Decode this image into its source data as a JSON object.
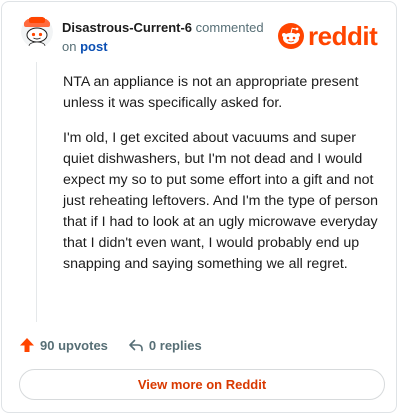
{
  "comment": {
    "author": "Disastrous-Current-6",
    "action_text": " commented on ",
    "post_link": "post",
    "paragraphs": [
      "NTA an appliance is not an appropriate present unless it was specifically asked for.",
      "I'm old, I get excited about vacuums and super quiet dishwashers, but I'm not dead and I would expect my so to put some effort into a gift and not just reheating leftovers. And I'm the type of person that if I had to look at an ugly microwave everyday that I didn't even want, I would probably end up snapping and saying something we all regret."
    ]
  },
  "brand": {
    "name": "reddit",
    "color": "#ff4500",
    "icon": "reddit-snoo-icon"
  },
  "actions": {
    "upvotes_label": "90 upvotes",
    "replies_label": "0 replies",
    "upvote_icon": "upvote-arrow-icon",
    "reply_icon": "reply-arrow-icon",
    "upvote_color": "#ff4500"
  },
  "footer": {
    "view_more_label": "View more on Reddit",
    "link_color": "#d93900"
  }
}
